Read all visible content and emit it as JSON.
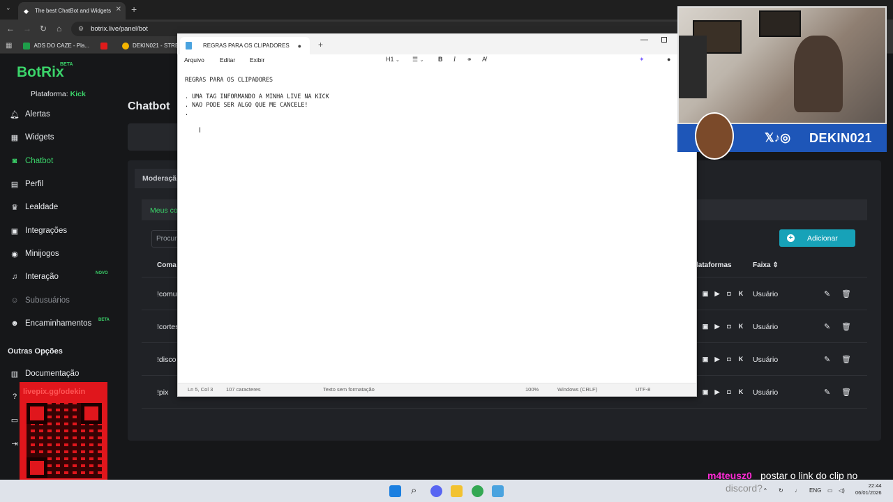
{
  "browser": {
    "tab_title": "The best ChatBot and Widgets",
    "url": "botrix.live/panel/bot",
    "bookmarks": [
      "ADS DO CAZE - Pla...",
      "DEKIN021 - STREA..."
    ]
  },
  "app": {
    "logo": "BotRix",
    "logo_badge": "BETA",
    "platform_label": "Plataforma:",
    "platform_value": "Kick",
    "page_title": "Chatbot",
    "sidebar": [
      {
        "label": "Alertas",
        "icon": "bell-icon"
      },
      {
        "label": "Widgets",
        "icon": "grid-icon"
      },
      {
        "label": "Chatbot",
        "icon": "robot-icon",
        "active": true
      },
      {
        "label": "Perfil",
        "icon": "id-card-icon"
      },
      {
        "label": "Lealdade",
        "icon": "trophy-icon"
      },
      {
        "label": "Integrações",
        "icon": "plug-icon"
      },
      {
        "label": "Minijogos",
        "icon": "gamepad-icon"
      },
      {
        "label": "Interação",
        "icon": "music-icon",
        "badge": "NOVO"
      },
      {
        "label": "Subusuários",
        "icon": "users-icon",
        "disabled": true
      },
      {
        "label": "Encaminhamentos",
        "icon": "share-icon",
        "badge": "BETA"
      }
    ],
    "other_options_heading": "Outras Opções",
    "other_options": [
      {
        "label": "Documentação",
        "icon": "book-icon"
      }
    ],
    "tabs": {
      "moderation": "Moderaçã",
      "my_commands": "Meus co"
    },
    "search_placeholder": "Procur",
    "add_button": "Adicionar",
    "columns": {
      "command": "Coma",
      "platforms": "lataformas",
      "band": "Faixa"
    },
    "commands": [
      {
        "name": "!comu",
        "band": "Usuário"
      },
      {
        "name": "!cortes",
        "band": "Usuário"
      },
      {
        "name": "!disco",
        "band": "Usuário"
      },
      {
        "name": "!pix",
        "band": "Usuário"
      }
    ]
  },
  "notepad": {
    "tab_title": "REGRAS PARA OS CLIPADORES",
    "menu": [
      "Arquivo",
      "Editar",
      "Exibir"
    ],
    "heading_tool": "H1",
    "content": "REGRAS PARA OS CLIPADORES\n\n. UMA TAG INFORMANDO A MINHA LIVE NA KICK\n. NAO PODE SER ALGO QUE ME CANCELE!\n.",
    "status": {
      "position": "Ln 5, Col 3",
      "chars": "107 caracteres",
      "format": "Texto sem formatação",
      "zoom": "100%",
      "line_endings": "Windows (CRLF)",
      "encoding": "UTF-8"
    }
  },
  "overlays": {
    "cam_handle": "DEKIN021",
    "qr_text": "livepix.gg/odekin",
    "chat_user": "m4teusz0",
    "chat_message": "postar o link do clip no",
    "chat_message_2": "discord?"
  },
  "taskbar": {
    "lang": "ENG",
    "time": "22:44",
    "date": "06/01/2026"
  }
}
